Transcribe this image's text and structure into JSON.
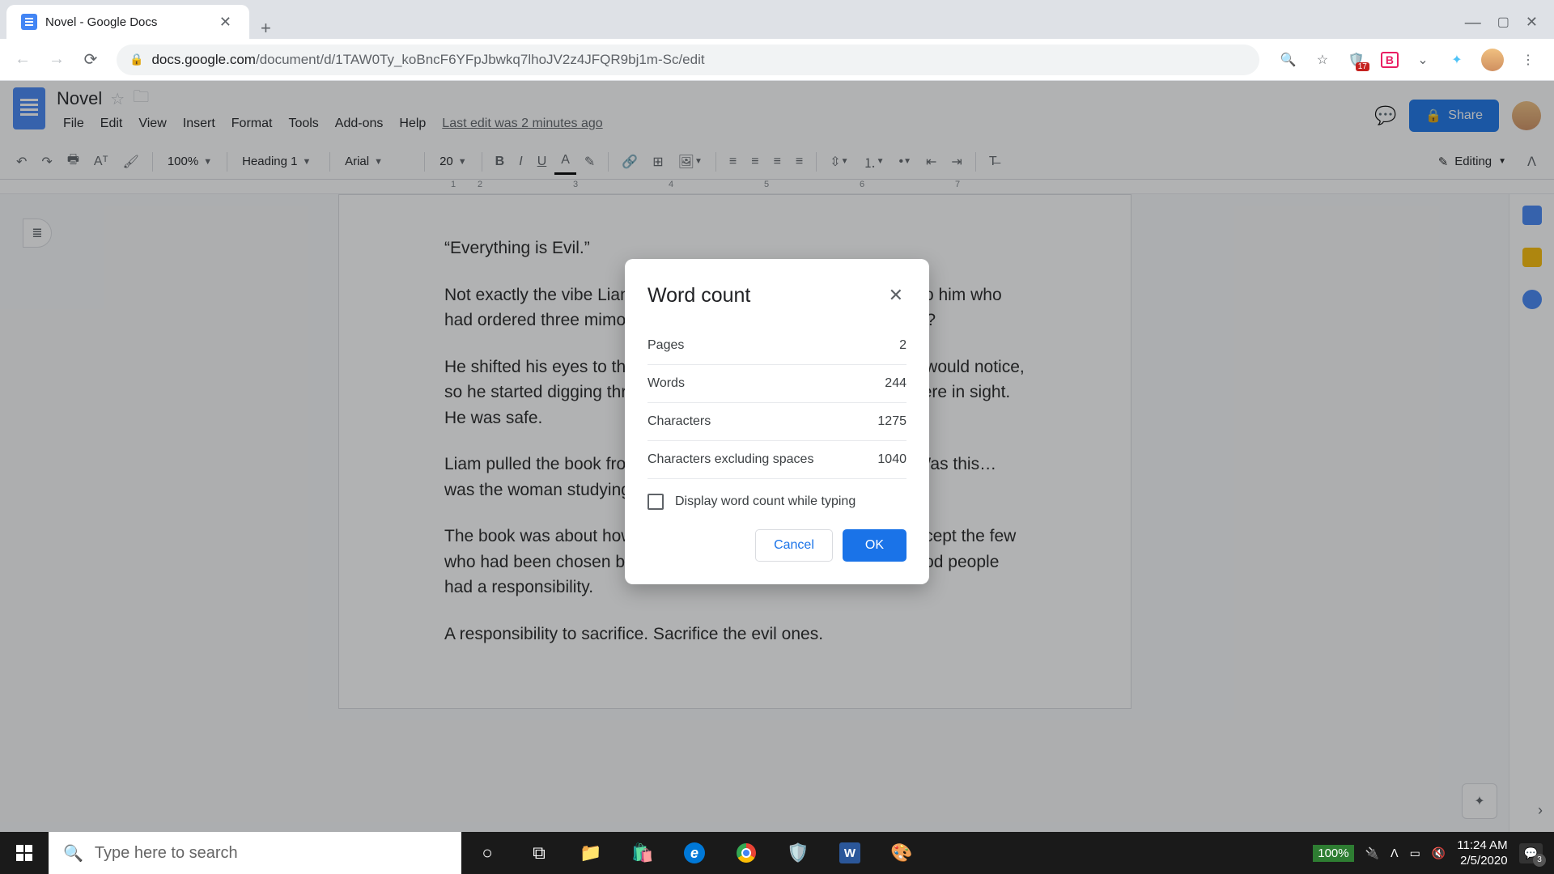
{
  "browser": {
    "tab_title": "Novel - Google Docs",
    "url_host": "docs.google.com",
    "url_path": "/document/d/1TAW0Ty_koBncF6YFpJbwkq7lhoJV2z4JFQR9bj1m-Sc/edit",
    "ext_badge": "17",
    "ext_b": "B"
  },
  "docs": {
    "title": "Novel",
    "menus": [
      "File",
      "Edit",
      "View",
      "Insert",
      "Format",
      "Tools",
      "Add-ons",
      "Help"
    ],
    "last_edit": "Last edit was 2 minutes ago",
    "share": "Share"
  },
  "toolbar": {
    "zoom": "100%",
    "style": "Heading 1",
    "font": "Arial",
    "size": "20",
    "editing": "Editing"
  },
  "ruler": [
    "1",
    "1",
    "2",
    "3",
    "4",
    "5",
    "6",
    "7"
  ],
  "document": {
    "p1": "“Everything is Evil.”",
    "p2": "Not exactly the vibe Liam expected from the jiggly woman next to him who had ordered three mimosas. What kind of book was she reading?",
    "p3": "He shifted his eyes to the seat beside him. Fast asleep. No one would notice, so he started digging through it. He checked that she was nowhere in sight. He was safe.",
    "p4": "Liam pulled the book from her bag and read the inside sleeve. Was this… was the woman studying a cult?",
    "p5": "The book was about how there was nothing anyone could do except the few who had been chosen by the universe to be good. And those good people had a responsibility.",
    "p6": "A responsibility to sacrifice. Sacrifice the evil ones."
  },
  "modal": {
    "title": "Word count",
    "rows": [
      {
        "label": "Pages",
        "value": "2"
      },
      {
        "label": "Words",
        "value": "244"
      },
      {
        "label": "Characters",
        "value": "1275"
      },
      {
        "label": "Characters excluding spaces",
        "value": "1040"
      }
    ],
    "checkbox_label": "Display word count while typing",
    "cancel": "Cancel",
    "ok": "OK"
  },
  "taskbar": {
    "search_placeholder": "Type here to search",
    "battery": "100%",
    "time": "11:24 AM",
    "date": "2/5/2020",
    "notif_count": "3"
  }
}
